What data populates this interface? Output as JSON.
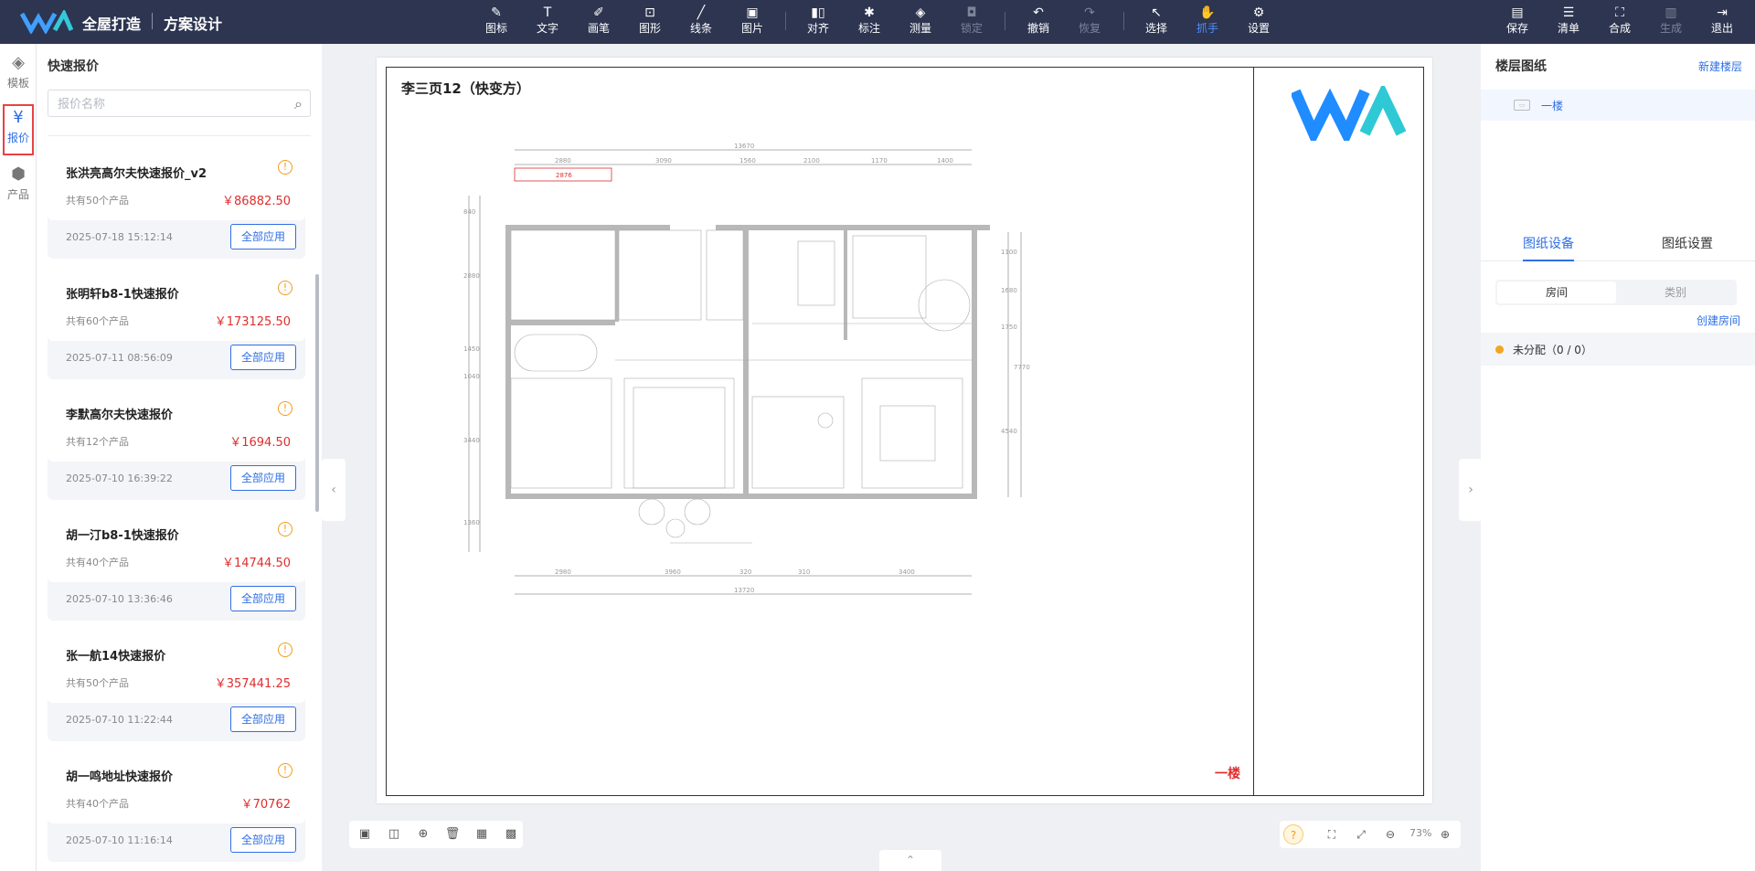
{
  "app": {
    "brand": "全屋打造",
    "module": "方案设计"
  },
  "toolbar": {
    "tools": [
      {
        "label": "图标",
        "icon": "shapes-icon"
      },
      {
        "label": "文字",
        "icon": "text-icon"
      },
      {
        "label": "画笔",
        "icon": "brush-icon"
      },
      {
        "label": "图形",
        "icon": "crop-icon"
      },
      {
        "label": "线条",
        "icon": "line-icon"
      },
      {
        "label": "图片",
        "icon": "image-icon"
      },
      {
        "label": "对齐",
        "icon": "align-icon"
      },
      {
        "label": "标注",
        "icon": "pin-icon"
      },
      {
        "label": "测量",
        "icon": "ruler-icon"
      },
      {
        "label": "锁定",
        "icon": "lock-icon"
      },
      {
        "label": "撤销",
        "icon": "undo-icon"
      },
      {
        "label": "恢复",
        "icon": "redo-icon"
      },
      {
        "label": "选择",
        "icon": "cursor-icon"
      },
      {
        "label": "抓手",
        "icon": "hand-icon"
      },
      {
        "label": "设置",
        "icon": "gear-icon"
      }
    ],
    "actions": [
      {
        "label": "保存",
        "icon": "save-icon"
      },
      {
        "label": "清单",
        "icon": "list-icon"
      },
      {
        "label": "合成",
        "icon": "compose-icon"
      },
      {
        "label": "生成",
        "icon": "generate-icon"
      },
      {
        "label": "退出",
        "icon": "exit-icon"
      }
    ]
  },
  "rail": {
    "items": [
      {
        "label": "模板"
      },
      {
        "label": "报价"
      },
      {
        "label": "产品"
      }
    ]
  },
  "quote_panel": {
    "title": "快速报价",
    "search_placeholder": "报价名称",
    "apply_label": "全部应用",
    "items": [
      {
        "name": "张洪亮高尔夫快速报价_v2",
        "count": "共有50个产品",
        "price": "￥86882.50",
        "date": "2025-07-18 15:12:14"
      },
      {
        "name": "张明轩b8-1快速报价",
        "count": "共有60个产品",
        "price": "￥173125.50",
        "date": "2025-07-11 08:56:09"
      },
      {
        "name": "李默高尔夫快速报价",
        "count": "共有12个产品",
        "price": "￥1694.50",
        "date": "2025-07-10 16:39:22"
      },
      {
        "name": "胡一汀b8-1快速报价",
        "count": "共有40个产品",
        "price": "￥14744.50",
        "date": "2025-07-10 13:36:46"
      },
      {
        "name": "张一航14快速报价",
        "count": "共有50个产品",
        "price": "￥357441.25",
        "date": "2025-07-10 11:22:44"
      },
      {
        "name": "胡一鸣地址快速报价",
        "count": "共有40个产品",
        "price": "￥70762",
        "date": "2025-07-10 11:16:14"
      }
    ]
  },
  "sheet": {
    "title": "李三页12（快变方）",
    "floor_label": "一楼",
    "dims_top": [
      "13670",
      "2880",
      "3090",
      "1560",
      "2100",
      "1170",
      "1400"
    ],
    "dims_bottom": [
      "2980",
      "3960",
      "320",
      "310",
      "3400"
    ],
    "dims_total_bottom": "13720",
    "dim_highlight": "2876",
    "dims_left": [
      "840",
      "2880",
      "1450",
      "1040",
      "3440",
      "1360"
    ],
    "dims_right": [
      "1100",
      "1680",
      "1750",
      "7770",
      "4540"
    ]
  },
  "zoom": {
    "value": "73%"
  },
  "right_panel": {
    "title": "楼层图纸",
    "new_floor": "新建楼层",
    "floors": [
      {
        "name": "一楼"
      }
    ],
    "tabs": [
      "图纸设备",
      "图纸设置"
    ],
    "segments": [
      "房间",
      "类别"
    ],
    "create_room": "创建房间",
    "unassigned": "未分配（0 / 0）"
  },
  "colors": {
    "topbar": "#2d3550",
    "accent": "#2f6fe4",
    "price": "#e02d2d",
    "warning": "#f29b1e"
  }
}
